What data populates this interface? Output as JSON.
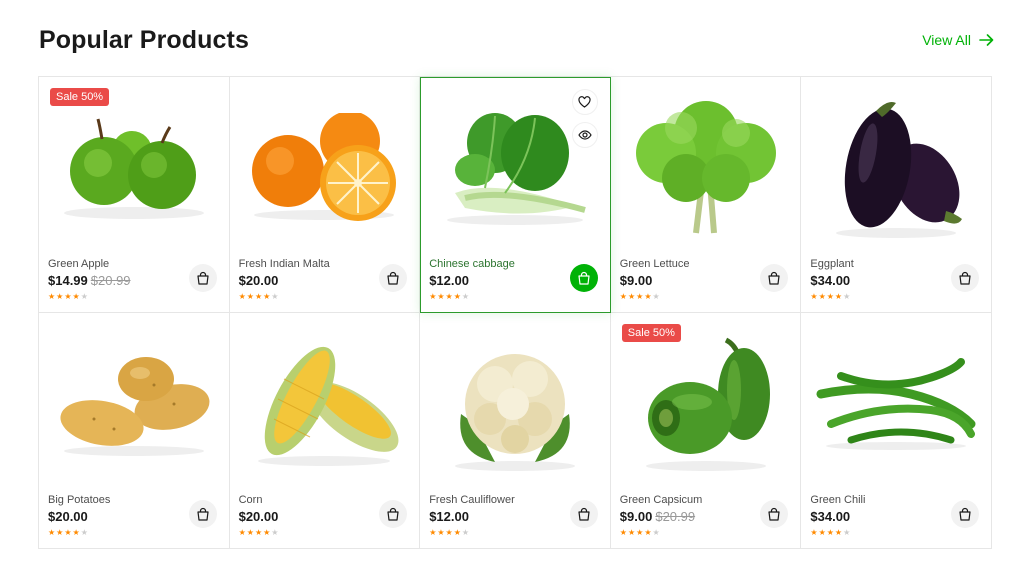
{
  "header": {
    "title": "Popular Products",
    "view_all": "View All"
  },
  "colors": {
    "accent": "#00b207",
    "sale": "#ea4b48",
    "star": "#ff8a00",
    "active_border": "#2c9b2c"
  },
  "products": [
    {
      "name": "Green Apple",
      "price": "$14.99",
      "old_price": "$20.99",
      "badge": "Sale 50%",
      "rating": 4,
      "image": "green-apple"
    },
    {
      "name": "Fresh Indian Malta",
      "price": "$20.00",
      "old_price": "",
      "badge": "",
      "rating": 4,
      "image": "orange"
    },
    {
      "name": "Chinese cabbage",
      "price": "$12.00",
      "old_price": "",
      "badge": "",
      "rating": 4,
      "image": "bok-choy",
      "active": true
    },
    {
      "name": "Green Lettuce",
      "price": "$9.00",
      "old_price": "",
      "badge": "",
      "rating": 4,
      "image": "lettuce"
    },
    {
      "name": "Eggplant",
      "price": "$34.00",
      "old_price": "",
      "badge": "",
      "rating": 4,
      "image": "eggplant"
    },
    {
      "name": "Big Potatoes",
      "price": "$20.00",
      "old_price": "",
      "badge": "",
      "rating": 4,
      "image": "potato"
    },
    {
      "name": "Corn",
      "price": "$20.00",
      "old_price": "",
      "badge": "",
      "rating": 4,
      "image": "corn"
    },
    {
      "name": "Fresh Cauliflower",
      "price": "$12.00",
      "old_price": "",
      "badge": "",
      "rating": 4,
      "image": "cauliflower"
    },
    {
      "name": "Green Capsicum",
      "price": "$9.00",
      "old_price": "$20.99",
      "badge": "Sale 50%",
      "rating": 4,
      "image": "capsicum"
    },
    {
      "name": "Green Chili",
      "price": "$34.00",
      "old_price": "",
      "badge": "",
      "rating": 4,
      "image": "chili"
    }
  ]
}
